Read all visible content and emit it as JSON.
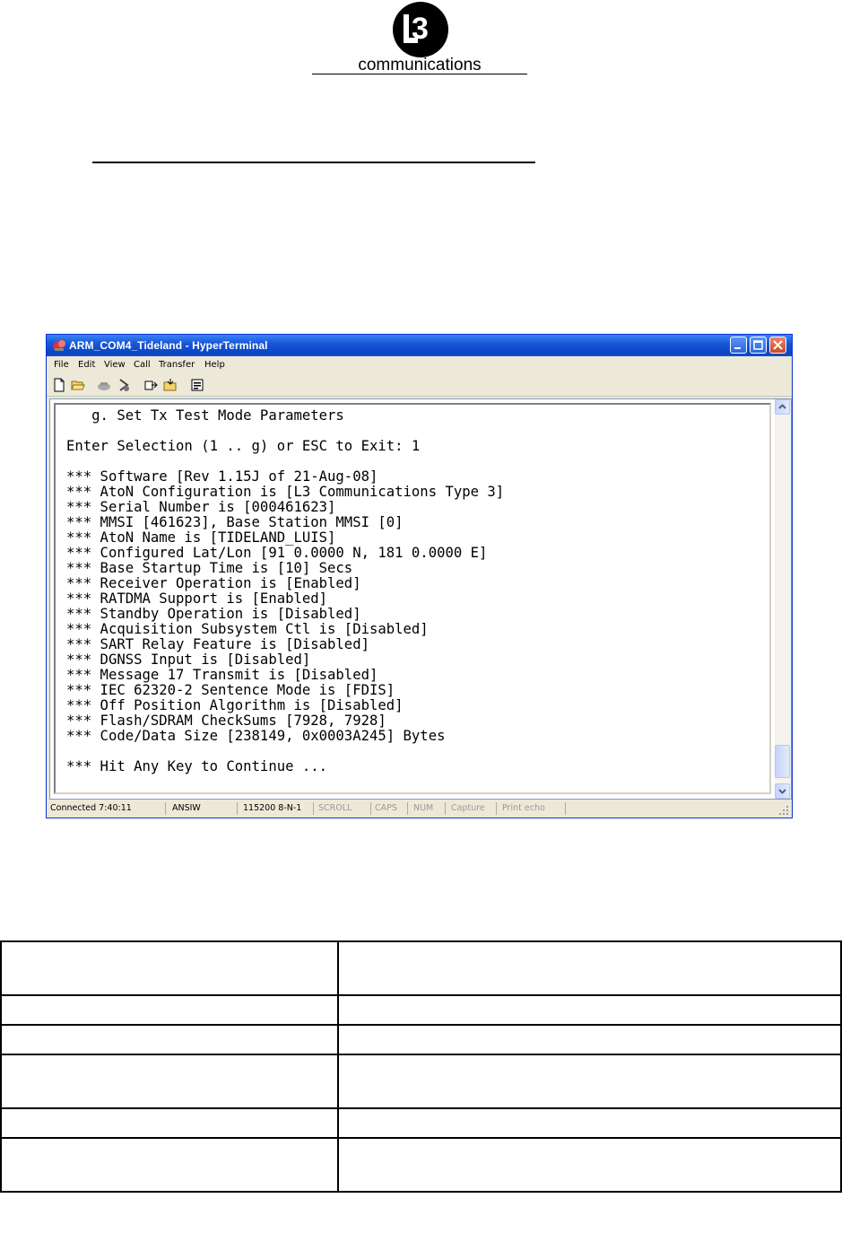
{
  "logo": {
    "mark_text": "L3",
    "wordmark": "communications"
  },
  "window": {
    "title": "ARM_COM4_Tideland - HyperTerminal",
    "menu": [
      "File",
      "Edit",
      "View",
      "Call",
      "Transfer",
      "Help"
    ],
    "toolbar_icons": [
      "new-icon",
      "open-icon",
      "connect-icon",
      "disconnect-icon",
      "send-icon",
      "receive-icon",
      "properties-icon"
    ],
    "terminal_lines": [
      "   g. Set Tx Test Mode Parameters",
      "",
      "Enter Selection (1 .. g) or ESC to Exit: 1",
      "",
      "*** Software [Rev 1.15J of 21-Aug-08]",
      "*** AtoN Configuration is [L3 Communications Type 3]",
      "*** Serial Number is [000461623]",
      "*** MMSI [461623], Base Station MMSI [0]",
      "*** AtoN Name is [TIDELAND_LUIS]",
      "*** Configured Lat/Lon [91 0.0000 N, 181 0.0000 E]",
      "*** Base Startup Time is [10] Secs",
      "*** Receiver Operation is [Enabled]",
      "*** RATDMA Support is [Enabled]",
      "*** Standby Operation is [Disabled]",
      "*** Acquisition Subsystem Ctl is [Disabled]",
      "*** SART Relay Feature is [Disabled]",
      "*** DGNSS Input is [Disabled]",
      "*** Message 17 Transmit is [Disabled]",
      "*** IEC 62320-2 Sentence Mode is [FDIS]",
      "*** Off Position Algorithm is [Disabled]",
      "*** Flash/SDRAM CheckSums [7928, 7928]",
      "*** Code/Data Size [238149, 0x0003A245] Bytes",
      "",
      "*** Hit Any Key to Continue ..."
    ],
    "status": [
      "Connected 7:40:11",
      "ANSIW",
      "115200 8-N-1",
      "SCROLL",
      "CAPS",
      "NUM",
      "Capture",
      "Print echo"
    ]
  },
  "table": {
    "row_heights": [
      "tall",
      "short",
      "short",
      "tall",
      "short",
      "tall"
    ]
  }
}
